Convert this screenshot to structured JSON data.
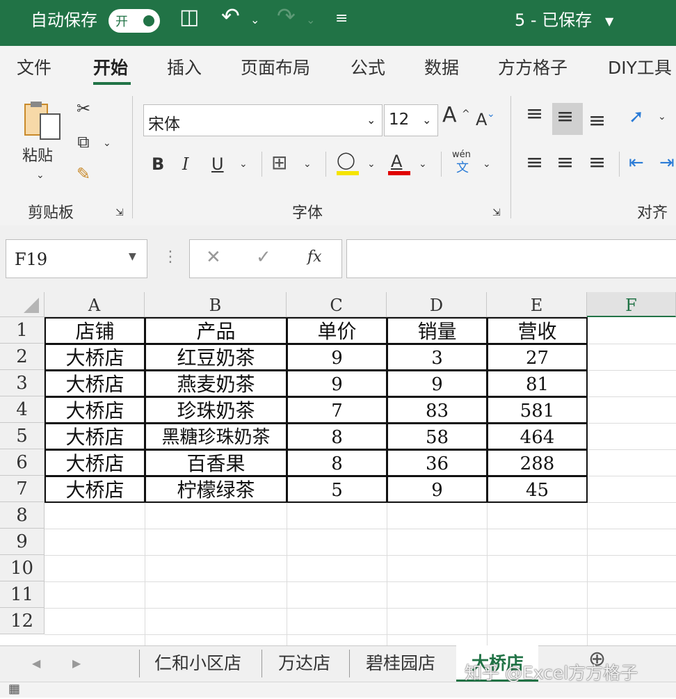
{
  "titlebar": {
    "autosave_label": "自动保存",
    "toggle_state": "开",
    "doc_title": "5 - 已保存"
  },
  "tabs": [
    "文件",
    "开始",
    "插入",
    "页面布局",
    "公式",
    "数据",
    "方方格子",
    "DIY工具"
  ],
  "active_tab": "开始",
  "ribbon": {
    "clipboard": {
      "paste_label": "粘贴",
      "group_label": "剪贴板"
    },
    "font": {
      "font_name": "宋体",
      "font_size": "12",
      "group_label": "字体",
      "grow": "A",
      "shrink": "A",
      "phonetic_top": "wén",
      "phonetic_bottom": "文"
    },
    "align": {
      "group_label": "对齐方"
    },
    "colors": {
      "highlight": "#f5e400",
      "font_color": "#e00000",
      "accent": "#217346"
    }
  },
  "formula_bar": {
    "name_box": "F19",
    "fx_label": "fx",
    "formula": ""
  },
  "columns": [
    "A",
    "B",
    "C",
    "D",
    "E",
    "F"
  ],
  "row_numbers": [
    "1",
    "2",
    "3",
    "4",
    "5",
    "6",
    "7",
    "8",
    "9",
    "10",
    "11",
    "12"
  ],
  "table": {
    "headers": [
      "店铺",
      "产品",
      "单价",
      "销量",
      "营收"
    ],
    "rows": [
      [
        "大桥店",
        "红豆奶茶",
        "9",
        "3",
        "27"
      ],
      [
        "大桥店",
        "燕麦奶茶",
        "9",
        "9",
        "81"
      ],
      [
        "大桥店",
        "珍珠奶茶",
        "7",
        "83",
        "581"
      ],
      [
        "大桥店",
        "黑糖珍珠奶茶",
        "8",
        "58",
        "464"
      ],
      [
        "大桥店",
        "百香果",
        "8",
        "36",
        "288"
      ],
      [
        "大桥店",
        "柠檬绿茶",
        "5",
        "9",
        "45"
      ]
    ]
  },
  "sheet_tabs": [
    "仁和小区店",
    "万达店",
    "碧桂园店",
    "大桥店"
  ],
  "active_sheet": "大桥店",
  "watermark": "知乎 @Excel方方格子"
}
